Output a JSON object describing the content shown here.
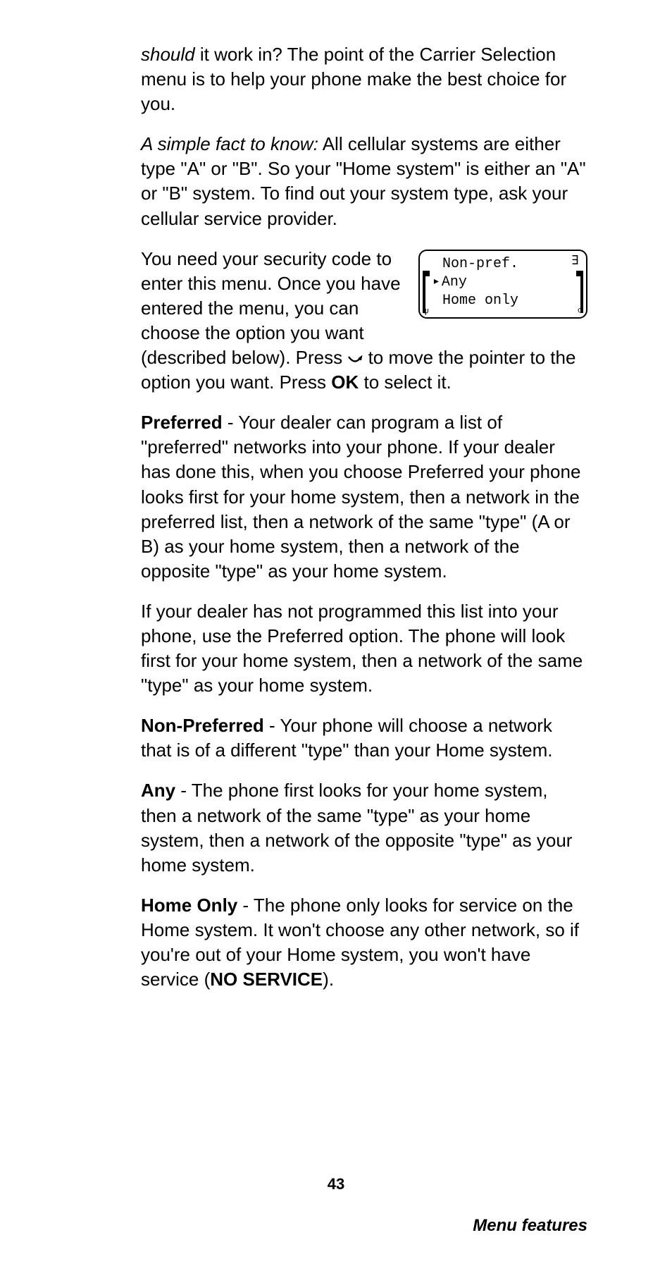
{
  "para1": {
    "lead_italic": "should",
    "rest": " it work in? The point of the Carrier Selection menu is to help your phone make the best choice for you."
  },
  "para2": {
    "lead_italic": "A simple fact to know:",
    "rest": " All cellular systems are either type \"A\" or \"B\". So your \"Home system\" is either an \"A\" or \"B\" system. To find out your system type, ask your cellular service provider."
  },
  "screen": {
    "signal_glyph": "∃",
    "line1": "Non-pref.",
    "line2_caret": "▸",
    "line2": "Any",
    "line3": "Home only",
    "antenna_glyph_left": "Ψ",
    "antenna_glyph_right": "ᴼ"
  },
  "para3": {
    "pre": "You need your security code to enter this menu. Once you have entered the menu, you can choose the option you want (described below). Press ",
    "arrow": "▾",
    "post": " to move the pointer to the option you want. Press ",
    "okbold": "OK",
    "post2": " to select it."
  },
  "pref": {
    "head": "Preferred",
    "body": " - Your dealer can program a list of \"preferred\" networks into your phone. If your dealer has done this, when you choose Preferred your phone looks first for your home system, then a network in the preferred list, then a network of the same \"type\" (A or B) as your home system, then a network of the opposite \"type\" as your home system."
  },
  "pref2": "If your dealer has not programmed this list into your phone, use the Preferred option. The phone will look first for your home system, then a network of the same \"type\" as your home system.",
  "nonpref": {
    "head": "Non-Preferred",
    "body": " - Your phone will choose a network that is of a different \"type\" than your Home system."
  },
  "any": {
    "head": "Any",
    "body": " - The phone first looks for your home system, then a network of the same \"type\" as your home system, then a network of the opposite \"type\" as your home system."
  },
  "homeonly": {
    "head": "Home Only",
    "body": " - The phone only looks for service on the Home system. It won't choose any other network, so if you're out of your Home system, you won't have service (",
    "noservice": "NO SERVICE",
    "tail": ")."
  },
  "pagenum": "43",
  "footer": "Menu features"
}
